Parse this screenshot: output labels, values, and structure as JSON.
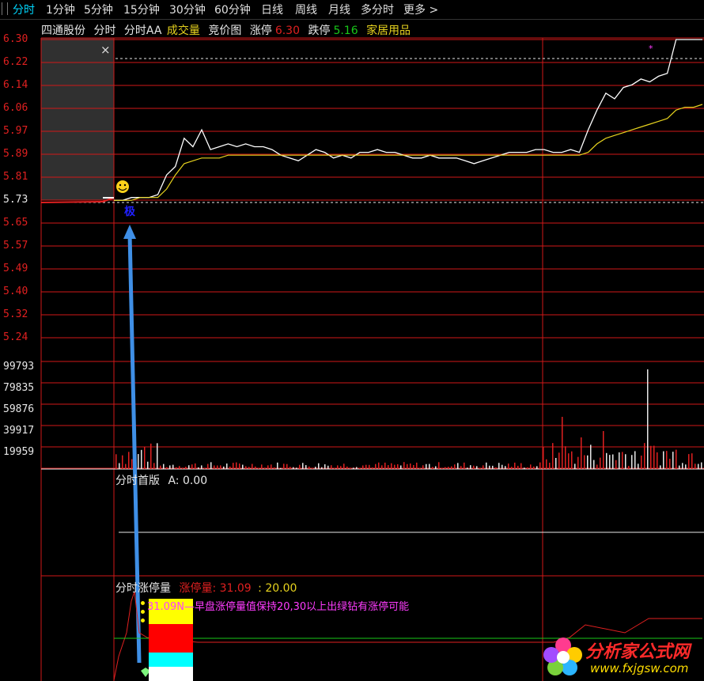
{
  "toolbar": {
    "tabs": [
      {
        "label": "分时",
        "active": true
      },
      {
        "label": "1分钟"
      },
      {
        "label": "5分钟"
      },
      {
        "label": "15分钟"
      },
      {
        "label": "30分钟"
      },
      {
        "label": "60分钟"
      },
      {
        "label": "日线"
      },
      {
        "label": "周线"
      },
      {
        "label": "月线"
      },
      {
        "label": "多分时"
      },
      {
        "label": "更多 >"
      }
    ]
  },
  "header": {
    "stock_name": "四通股份",
    "mode": "分时",
    "formula": "分时AA",
    "volume_label": "成交量",
    "auction_label": "竞价图",
    "limit_up_label": "涨停",
    "limit_up_value": "6.30",
    "limit_down_label": "跌停",
    "limit_down_value": "5.16",
    "sector": "家居用品"
  },
  "close_icon": "×",
  "price_axis": [
    "6.30",
    "6.22",
    "6.14",
    "6.06",
    "5.97",
    "5.89",
    "5.81",
    "5.73",
    "5.65",
    "5.57",
    "5.49",
    "5.40",
    "5.32",
    "5.24"
  ],
  "volume_axis": [
    "99793",
    "79835",
    "59876",
    "39917",
    "19959"
  ],
  "marker_char": "极",
  "panel1": {
    "title": "分时首版",
    "value_label": "A: 0.00"
  },
  "panel2": {
    "title": "分时涨停量",
    "label": "涨停量:",
    "value": "31.09",
    "sep": ":",
    "value2": "20.00"
  },
  "note": "31.09N—早盘涨停量值保持20,30以上出绿钻有涨停可能",
  "watermark": {
    "title": "分析家公式网",
    "url": "www.fxjgsw.com"
  },
  "colors": {
    "up": "#e02020",
    "avg": "#e6d21e",
    "price": "#ffffff",
    "accent": "#00d8ff",
    "note": "#ff3cff"
  },
  "chart_data": {
    "type": "line",
    "series": [
      {
        "values": [
          5.73,
          5.73,
          5.74,
          5.74,
          5.74,
          5.75,
          5.82,
          5.85,
          5.95,
          5.92,
          5.98,
          5.91,
          5.92,
          5.93,
          5.92,
          5.93,
          5.92,
          5.92,
          5.91,
          5.89,
          5.88,
          5.87,
          5.89,
          5.91,
          5.9,
          5.88,
          5.89,
          5.88,
          5.9,
          5.9,
          5.91,
          5.9,
          5.9,
          5.89,
          5.88,
          5.88,
          5.89,
          5.88,
          5.88,
          5.88,
          5.87,
          5.86,
          5.87,
          5.88,
          5.89,
          5.9,
          5.9,
          5.9,
          5.91,
          5.91,
          5.9,
          5.9,
          5.91,
          5.9,
          5.98,
          6.05,
          6.11,
          6.09,
          6.13,
          6.14,
          6.16,
          6.15,
          6.17,
          6.18,
          6.3,
          6.3,
          6.3,
          6.3
        ]
      },
      {
        "values": [
          5.73,
          5.73,
          5.73,
          5.74,
          5.74,
          5.74,
          5.77,
          5.82,
          5.86,
          5.87,
          5.88,
          5.88,
          5.88,
          5.89,
          5.89,
          5.89,
          5.89,
          5.89,
          5.89,
          5.89,
          5.89,
          5.89,
          5.89,
          5.89,
          5.89,
          5.89,
          5.89,
          5.89,
          5.89,
          5.89,
          5.89,
          5.89,
          5.89,
          5.89,
          5.89,
          5.89,
          5.89,
          5.89,
          5.89,
          5.89,
          5.89,
          5.89,
          5.89,
          5.89,
          5.89,
          5.89,
          5.89,
          5.89,
          5.89,
          5.89,
          5.89,
          5.89,
          5.89,
          5.89,
          5.9,
          5.93,
          5.95,
          5.96,
          5.97,
          5.98,
          5.99,
          6.0,
          6.01,
          6.02,
          6.05,
          6.06,
          6.06,
          6.07
        ]
      }
    ],
    "ylim": [
      5.16,
      6.3
    ],
    "grid": true
  }
}
